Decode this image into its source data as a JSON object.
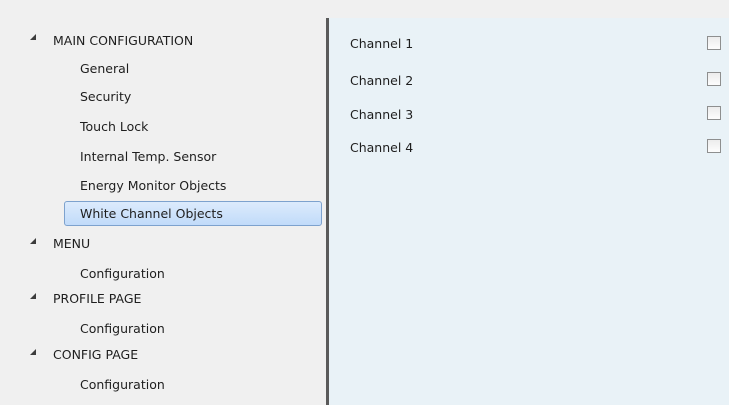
{
  "tree": {
    "sections": [
      {
        "label": "MAIN CONFIGURATION",
        "children": [
          "General",
          "Security",
          "Touch Lock",
          "Internal Temp. Sensor",
          "Energy Monitor Objects",
          "White Channel Objects"
        ]
      },
      {
        "label": "MENU",
        "children": [
          "Configuration"
        ]
      },
      {
        "label": "PROFILE PAGE",
        "children": [
          "Configuration"
        ]
      },
      {
        "label": "CONFIG PAGE",
        "children": [
          "Configuration"
        ]
      }
    ],
    "selected": "White Channel Objects"
  },
  "channels": [
    {
      "label": "Channel 1",
      "checked": false
    },
    {
      "label": "Channel 2",
      "checked": false
    },
    {
      "label": "Channel 3",
      "checked": false
    },
    {
      "label": "Channel 4",
      "checked": false
    }
  ]
}
